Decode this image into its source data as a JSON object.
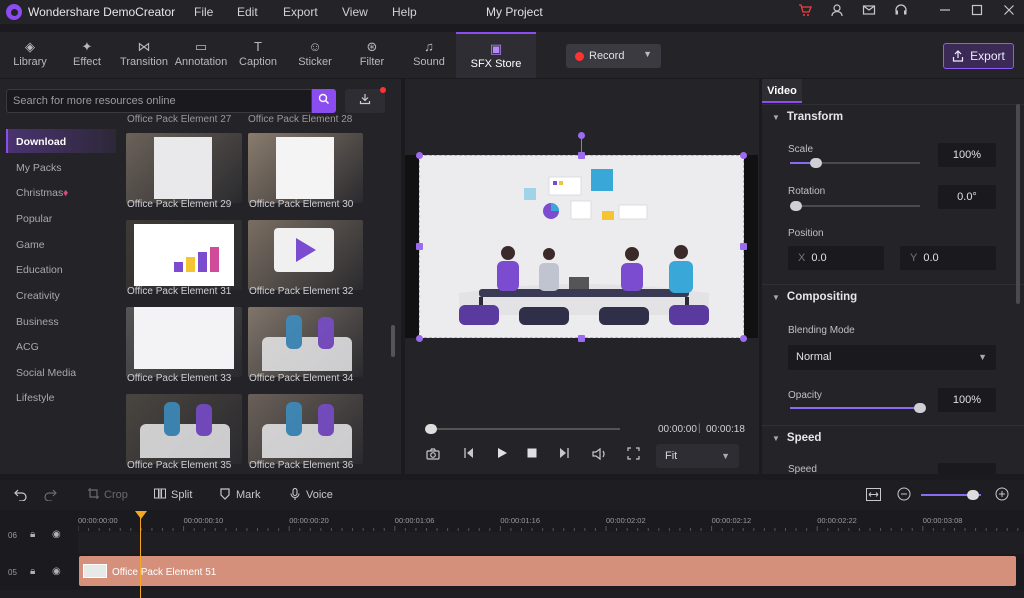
{
  "app": {
    "name": "Wondershare DemoCreator",
    "project_title": "My Project"
  },
  "menu": [
    "File",
    "Edit",
    "Export",
    "View",
    "Help"
  ],
  "tabs": [
    {
      "label": "Library",
      "icon": "cube-icon",
      "glyph": "◈"
    },
    {
      "label": "Effect",
      "icon": "wand-icon",
      "glyph": "✦"
    },
    {
      "label": "Transition",
      "icon": "transition-icon",
      "glyph": "⋈"
    },
    {
      "label": "Annotation",
      "icon": "annotation-icon",
      "glyph": "▭"
    },
    {
      "label": "Caption",
      "icon": "caption-icon",
      "glyph": "T"
    },
    {
      "label": "Sticker",
      "icon": "sticker-icon",
      "glyph": "☺"
    },
    {
      "label": "Filter",
      "icon": "filter-icon",
      "glyph": "⊛"
    },
    {
      "label": "Sound",
      "icon": "sound-icon",
      "glyph": "♫"
    },
    {
      "label": "SFX Store",
      "icon": "store-icon",
      "glyph": "▣"
    }
  ],
  "record_label": "Record",
  "export_label": "Export",
  "search": {
    "placeholder": "Search for more resources online"
  },
  "categories": [
    "Download",
    "My Packs",
    "Christmas",
    "Popular",
    "Game",
    "Education",
    "Creativity",
    "Business",
    "ACG",
    "Social Media",
    "Lifestyle"
  ],
  "assets": {
    "partial_top": [
      "Office Pack Element 27",
      "Office Pack Element 28"
    ],
    "items": [
      "Office Pack Element 29",
      "Office Pack Element 30",
      "Office Pack Element 31",
      "Office Pack Element 32",
      "Office Pack Element 33",
      "Office Pack Element 34",
      "Office Pack Element 35",
      "Office Pack Element 36"
    ]
  },
  "player": {
    "current": "00:00:00",
    "duration": "00:00:18",
    "fit": "Fit",
    "progress": 0.0
  },
  "properties": {
    "tab": "Video",
    "transform": "Transform",
    "scale_label": "Scale",
    "scale_value": "100%",
    "scale_fraction": 0.2,
    "rotation_label": "Rotation",
    "rotation_value": "0.0°",
    "rotation_fraction": 0.0,
    "position_label": "Position",
    "x_label": "X",
    "x_value": "0.0",
    "y_label": "Y",
    "y_value": "0.0",
    "compositing": "Compositing",
    "blending_label": "Blending Mode",
    "blending_value": "Normal",
    "opacity_label": "Opacity",
    "opacity_value": "100%",
    "opacity_fraction": 1.0,
    "speed_section": "Speed",
    "speed_label": "Speed"
  },
  "timeline_tools": {
    "crop": "Crop",
    "split": "Split",
    "mark": "Mark",
    "voice": "Voice"
  },
  "ruler": [
    "00:00:00:00",
    "00:00:00:10",
    "00:00:00:20",
    "00:00:01:06",
    "00:00:01:16",
    "00:00:02:02",
    "00:00:02:12",
    "00:00:02:22",
    "00:00:03:08"
  ],
  "tracks": [
    {
      "number": "06"
    },
    {
      "number": "05",
      "clip": "Office Pack Element 51"
    }
  ],
  "colors": {
    "accent": "#8b4cf0",
    "clip": "#d4907a",
    "playhead": "#f5a623"
  }
}
